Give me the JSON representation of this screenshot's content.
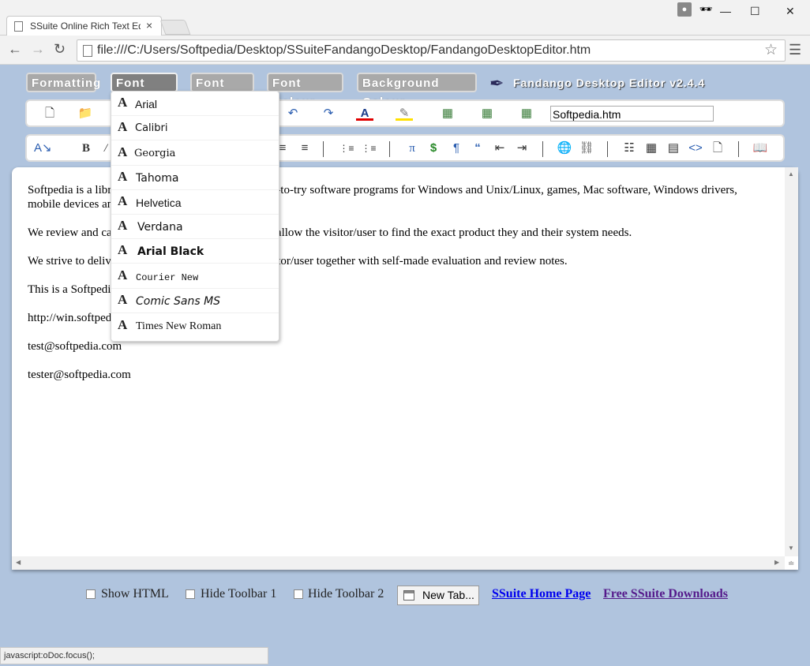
{
  "browser": {
    "tab_title": "SSuite Online Rich Text Ed",
    "tab_close": "×",
    "url": "file:///C:/Users/Softpedia/Desktop/SSuiteFandangoDesktop/FandangoDesktopEditor.htm",
    "window_controls": {
      "minimize": "—",
      "maximize": "☐",
      "close": "✕"
    },
    "status_text": "javascript:oDoc.focus();"
  },
  "menu": {
    "buttons": [
      "Formatting",
      "Font Type",
      "Font Size",
      "Font Colour",
      "Background Colour"
    ],
    "active": "Font Type",
    "brand": "Fandango Desktop Editor v2.4.4"
  },
  "toolbar1": {
    "filename": "Softpedia.htm"
  },
  "editor": {
    "paragraphs": [
      "Softpedia is a library of over 1,300,000 free and free-to-try software programs for Windows and Unix/Linux, games, Mac software, Windows drivers, mobile devices and IT-related articles.",
      "We review and categorize these products in order to allow the visitor/user to find the exact product they and their system needs.",
      "We strive to deliver only the best products to the visitor/user together with self-made evaluation and review notes.",
      "This is a Softpedia test.",
      "http://win.softpedia.com",
      "test@softpedia.com",
      "tester@softpedia.com"
    ]
  },
  "font_menu": {
    "items": [
      "Arial",
      "Calibri",
      "Georgia",
      "Tahoma",
      "Helvetica",
      "Verdana",
      "Arial Black",
      "Courier New",
      "Comic Sans MS",
      "Times New Roman"
    ]
  },
  "bottom_bar": {
    "show_html": "Show HTML",
    "hide_toolbar1": "Hide Toolbar 1",
    "hide_toolbar2": "Hide Toolbar 2",
    "new_tab": "New Tab...",
    "home_link": "SSuite Home Page",
    "downloads_link": "Free SSuite Downloads"
  },
  "colors": {
    "page_background": "#b0c4de",
    "menu_button": "#a9a9a9",
    "link_blue": "#0000ee",
    "link_visited": "#551a8b"
  }
}
